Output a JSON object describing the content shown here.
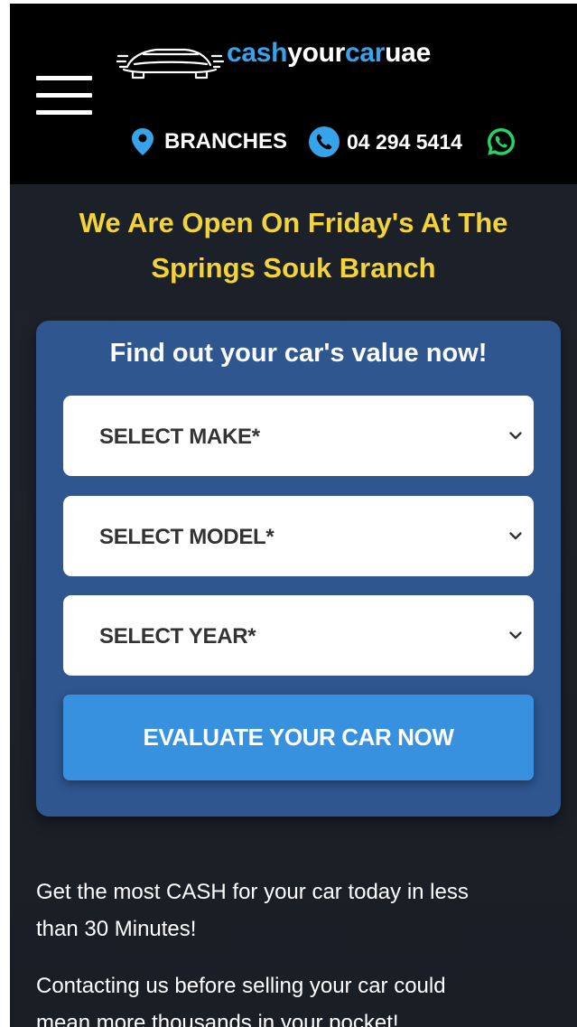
{
  "header": {
    "logo": {
      "part1": "cash",
      "part2": "your",
      "part3": "car",
      "part4": "uae"
    },
    "branches_label": "BRANCHES",
    "phone_number": "04 294 5414"
  },
  "banner": {
    "line1": "We Are Open On Friday's At The",
    "line2": "Springs Souk Branch"
  },
  "form": {
    "title": "Find out your car's value now!",
    "make_select": "SELECT MAKE*",
    "model_select": "SELECT MODEL*",
    "year_select": "SELECT YEAR*",
    "submit_label": "EVALUATE YOUR CAR NOW"
  },
  "content": {
    "paragraph1_line1": "Get the most CASH for your car today in less",
    "paragraph1_line2": "than 30 Minutes!",
    "paragraph2_line1": "Contacting us before selling your car could",
    "paragraph2_line2": "mean more thousands in your pocket!"
  },
  "colors": {
    "accent_blue": "#36a3ea",
    "banner_yellow": "#f2d33a",
    "form_card": "#2f568f",
    "button_blue": "#3891de",
    "whatsapp_green": "#25d366"
  },
  "icons": {
    "menu": "hamburger-menu-icon",
    "logo": "car-logo-icon",
    "branches": "map-pin-icon",
    "phone": "phone-icon",
    "whatsapp": "whatsapp-icon",
    "select": "chevron-down-icon"
  }
}
